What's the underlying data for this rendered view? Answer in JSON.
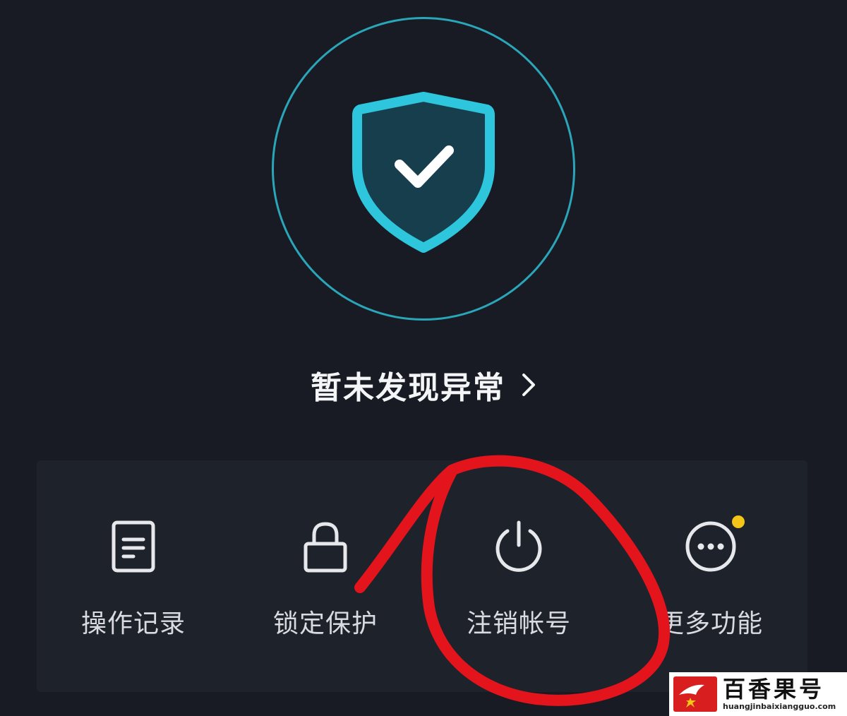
{
  "status": {
    "text": "暂未发现异常",
    "chevron_icon": "chevron-right-icon"
  },
  "shield": {
    "icon": "shield-check-icon",
    "accent": "#2ec6dd",
    "ring_color": "#2aa6b8"
  },
  "actions": [
    {
      "label": "操作记录",
      "icon": "document-icon"
    },
    {
      "label": "锁定保护",
      "icon": "lock-icon"
    },
    {
      "label": "注销帐号",
      "icon": "power-icon"
    },
    {
      "label": "更多功能",
      "icon": "more-icon",
      "badge_color": "#f5c518"
    }
  ],
  "annotation": {
    "color": "#e3141b",
    "type": "hand-drawn-circle"
  },
  "watermark": {
    "name": "百香果号",
    "url": "huangjinbaixiangguo.com"
  }
}
